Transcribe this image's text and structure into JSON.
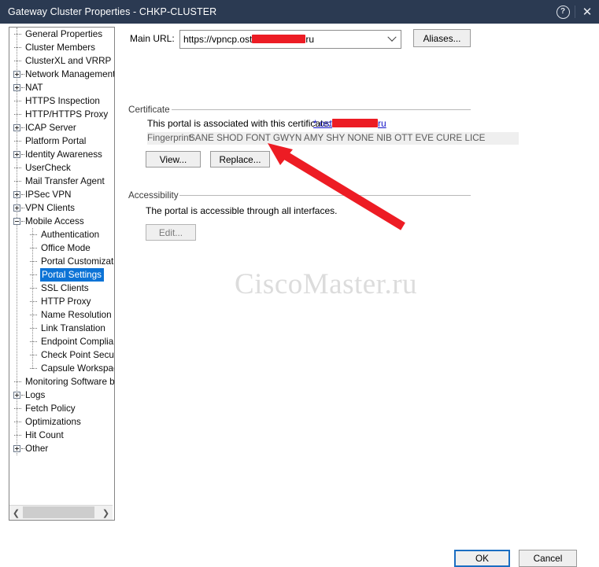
{
  "window": {
    "title": "Gateway Cluster Properties - CHKP-CLUSTER",
    "help_icon": "help-circle-icon",
    "close_icon": "close-icon"
  },
  "tree": {
    "items": [
      {
        "label": "General Properties",
        "glyph": "dash",
        "indent": 0,
        "selected": false
      },
      {
        "label": "Cluster Members",
        "glyph": "dash",
        "indent": 0,
        "selected": false
      },
      {
        "label": "ClusterXL and VRRP",
        "glyph": "dash",
        "indent": 0,
        "selected": false
      },
      {
        "label": "Network Management",
        "glyph": "plus",
        "indent": 0,
        "selected": false
      },
      {
        "label": "NAT",
        "glyph": "plus",
        "indent": 0,
        "selected": false
      },
      {
        "label": "HTTPS Inspection",
        "glyph": "dash",
        "indent": 0,
        "selected": false
      },
      {
        "label": "HTTP/HTTPS Proxy",
        "glyph": "dash",
        "indent": 0,
        "selected": false
      },
      {
        "label": "ICAP Server",
        "glyph": "plus",
        "indent": 0,
        "selected": false
      },
      {
        "label": "Platform Portal",
        "glyph": "dash",
        "indent": 0,
        "selected": false
      },
      {
        "label": "Identity Awareness",
        "glyph": "plus",
        "indent": 0,
        "selected": false
      },
      {
        "label": "UserCheck",
        "glyph": "dash",
        "indent": 0,
        "selected": false
      },
      {
        "label": "Mail Transfer Agent",
        "glyph": "dash",
        "indent": 0,
        "selected": false
      },
      {
        "label": "IPSec VPN",
        "glyph": "plus",
        "indent": 0,
        "selected": false
      },
      {
        "label": "VPN Clients",
        "glyph": "plus",
        "indent": 0,
        "selected": false
      },
      {
        "label": "Mobile Access",
        "glyph": "minus",
        "indent": 0,
        "selected": false
      },
      {
        "label": "Authentication",
        "glyph": "dash",
        "indent": 1,
        "selected": false
      },
      {
        "label": "Office Mode",
        "glyph": "dash",
        "indent": 1,
        "selected": false
      },
      {
        "label": "Portal Customizatio",
        "glyph": "dash",
        "indent": 1,
        "selected": false
      },
      {
        "label": "Portal Settings",
        "glyph": "dash",
        "indent": 1,
        "selected": true
      },
      {
        "label": "SSL Clients",
        "glyph": "dash",
        "indent": 1,
        "selected": false
      },
      {
        "label": "HTTP Proxy",
        "glyph": "dash",
        "indent": 1,
        "selected": false
      },
      {
        "label": "Name Resolution",
        "glyph": "dash",
        "indent": 1,
        "selected": false
      },
      {
        "label": "Link Translation",
        "glyph": "dash",
        "indent": 1,
        "selected": false
      },
      {
        "label": "Endpoint Complian",
        "glyph": "dash",
        "indent": 1,
        "selected": false
      },
      {
        "label": "Check Point Secur",
        "glyph": "dash",
        "indent": 1,
        "selected": false
      },
      {
        "label": "Capsule Workspac",
        "glyph": "dash",
        "indent": 1,
        "selected": false
      },
      {
        "label": "Monitoring Software bla",
        "glyph": "dash",
        "indent": 0,
        "selected": false
      },
      {
        "label": "Logs",
        "glyph": "plus",
        "indent": 0,
        "selected": false
      },
      {
        "label": "Fetch Policy",
        "glyph": "dash",
        "indent": 0,
        "selected": false
      },
      {
        "label": "Optimizations",
        "glyph": "dash",
        "indent": 0,
        "selected": false
      },
      {
        "label": "Hit Count",
        "glyph": "dash",
        "indent": 0,
        "selected": false
      },
      {
        "label": "Other",
        "glyph": "plus",
        "indent": 0,
        "selected": false
      }
    ],
    "scrollbar": {
      "left_arrow": "❮",
      "right_arrow": "❯"
    }
  },
  "main": {
    "url_label": "Main URL:",
    "url_value_prefix": "https://vpncp.ost",
    "url_value_suffix": "ru",
    "url_redacted": true,
    "dropdown_icon": "chevron-down-icon",
    "aliases_button": "Aliases...",
    "certificate": {
      "group_title": "Certificate",
      "description": "This portal is associated with this certificate:",
      "link_prefix": "*.ost",
      "link_suffix": "ru",
      "fingerprint_label": "Fingerprint:",
      "fingerprint_value": "SANE SHOD FONT GWYN AMY SHY NONE NIB OTT EVE CURE LICE",
      "view_button": "View...",
      "replace_button": "Replace..."
    },
    "accessibility": {
      "group_title": "Accessibility",
      "description": "The portal is accessible through all interfaces.",
      "edit_button": "Edit..."
    },
    "watermark": "CiscoMaster.ru",
    "annotation_arrow_color": "#ED1C24"
  },
  "footer": {
    "ok_button": "OK",
    "cancel_button": "Cancel"
  }
}
